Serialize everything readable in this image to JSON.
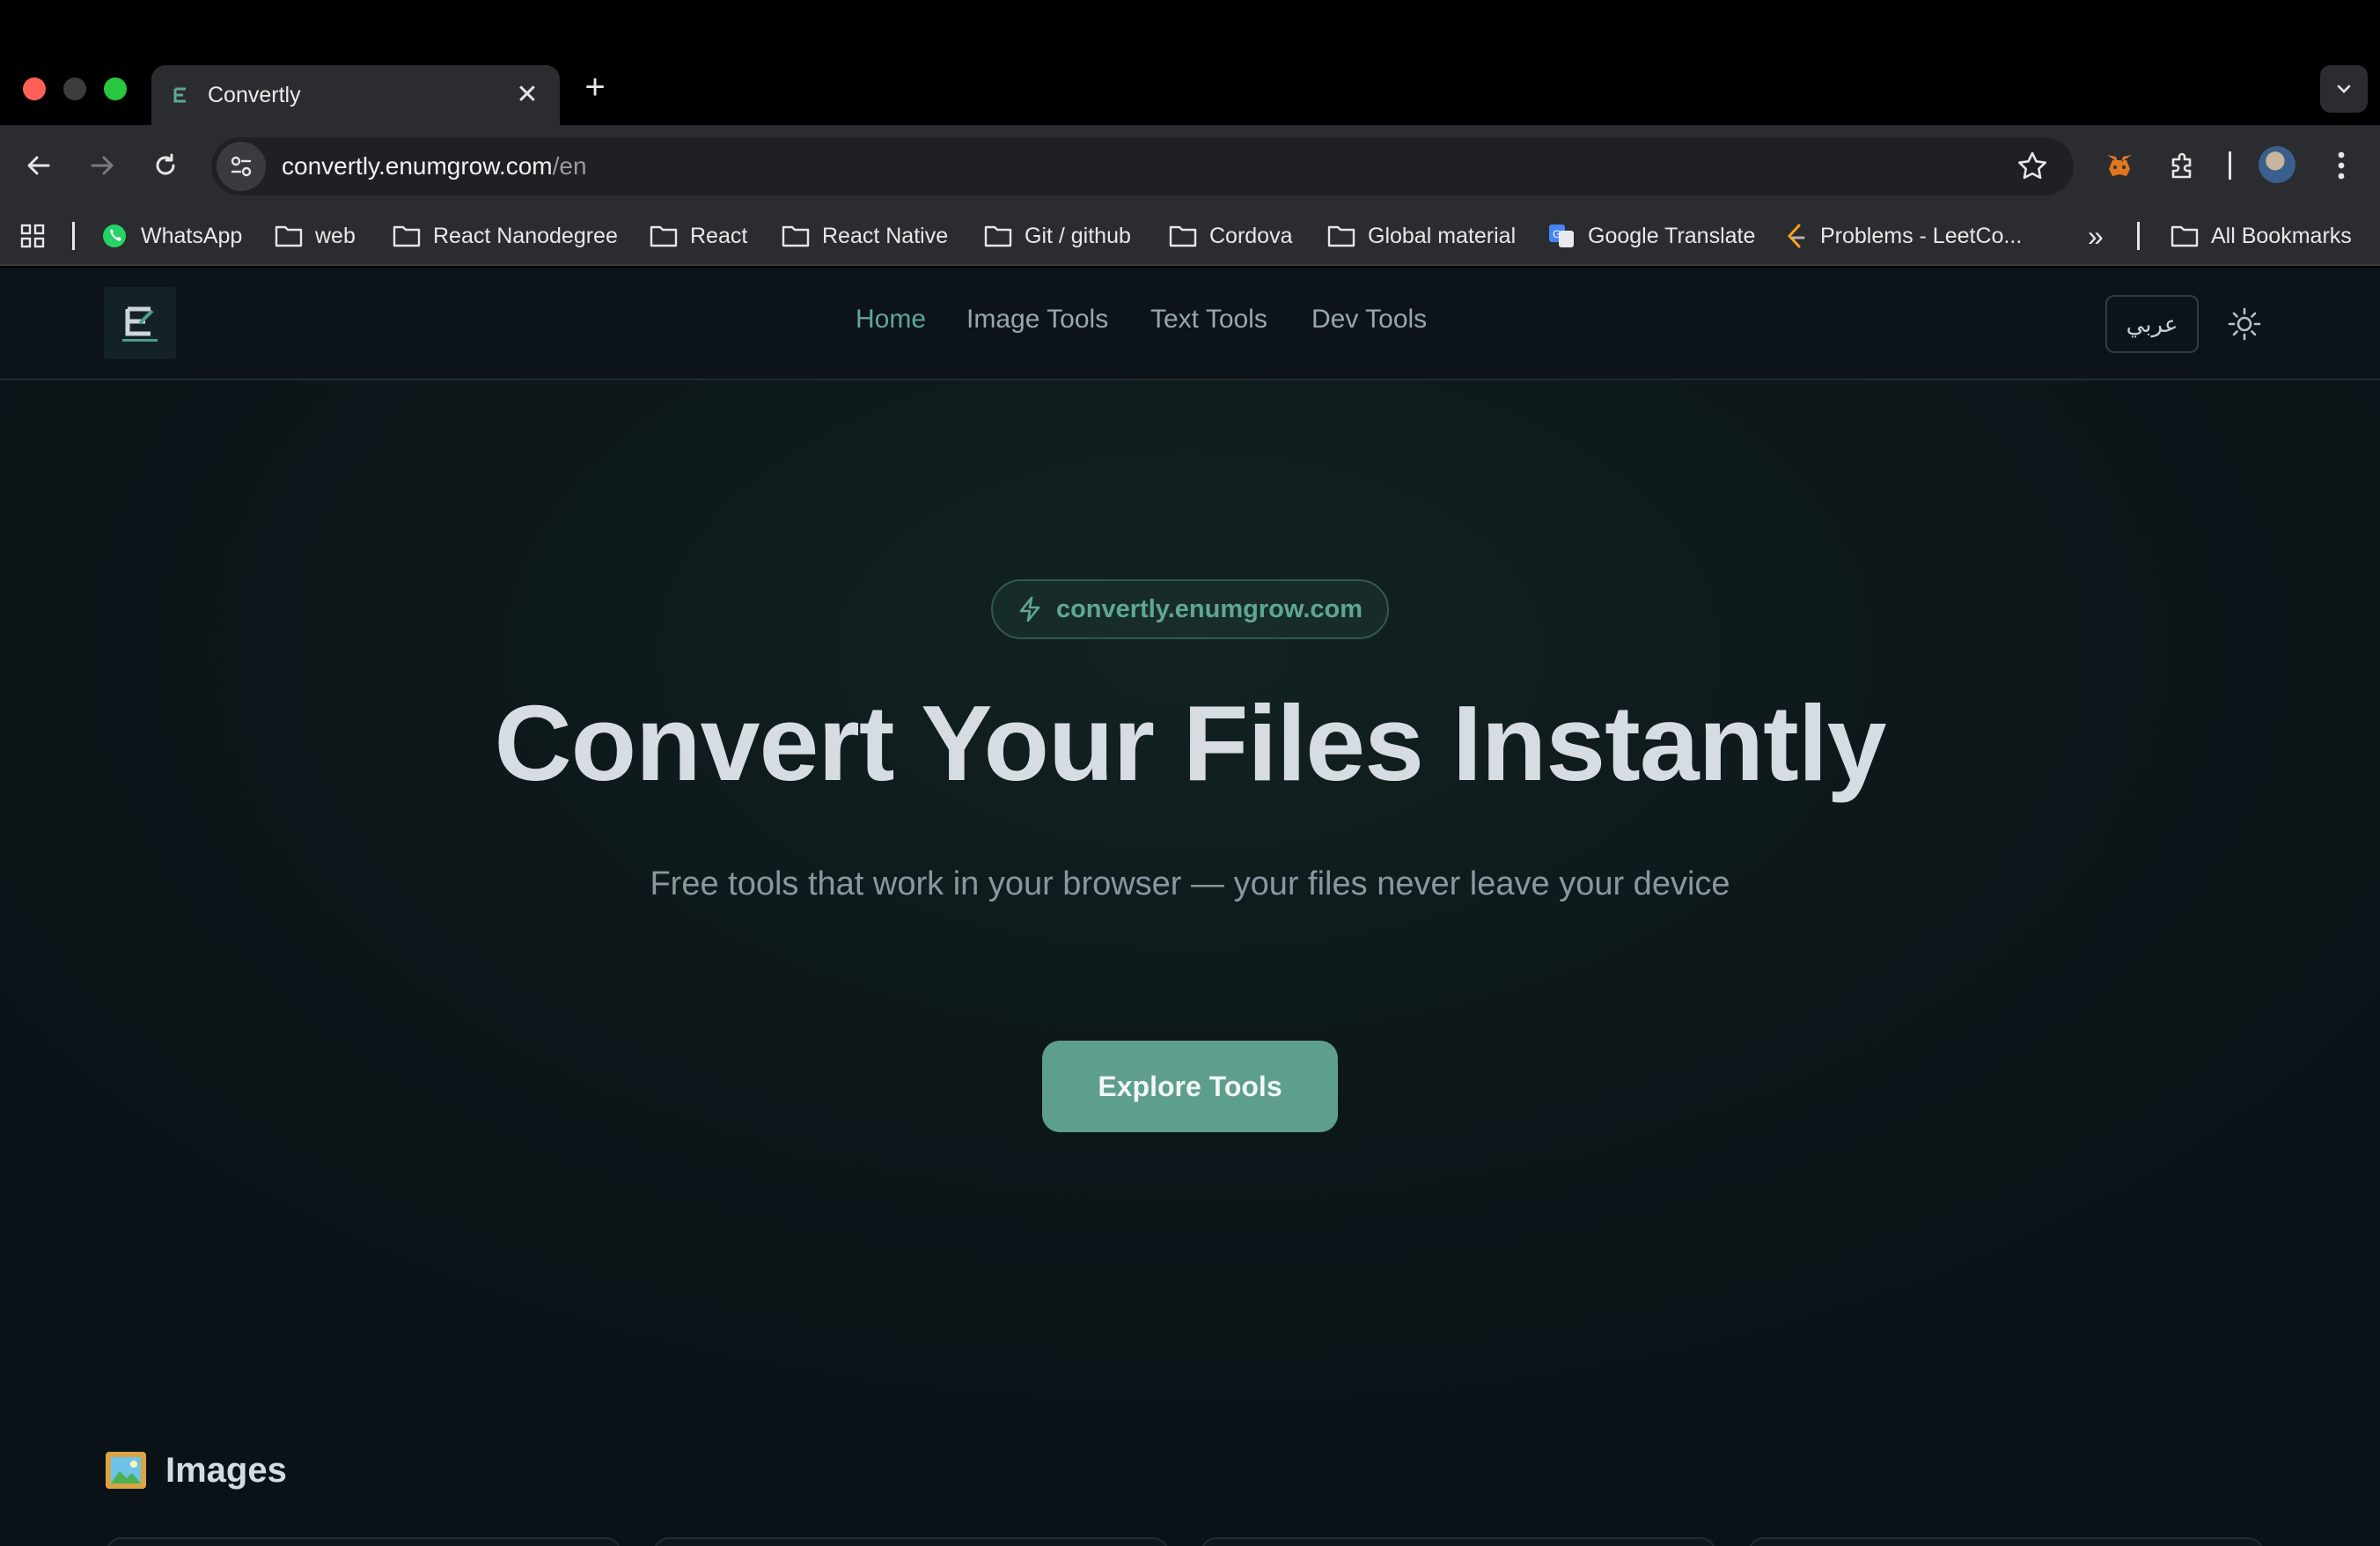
{
  "browser": {
    "tab": {
      "title": "Convertly",
      "close_glyph": "✕"
    },
    "new_tab_glyph": "+",
    "omnibox": {
      "host": "convertly.enumgrow.com",
      "path": "/en"
    },
    "bookmarks": [
      {
        "label": "WhatsApp",
        "icon": "whatsapp-icon"
      },
      {
        "label": "web",
        "icon": "folder-icon"
      },
      {
        "label": "React Nanodegree",
        "icon": "folder-icon"
      },
      {
        "label": "React",
        "icon": "folder-icon"
      },
      {
        "label": "React Native",
        "icon": "folder-icon"
      },
      {
        "label": "Git / github",
        "icon": "folder-icon"
      },
      {
        "label": "Cordova",
        "icon": "folder-icon"
      },
      {
        "label": "Global material",
        "icon": "folder-icon"
      },
      {
        "label": "Google Translate",
        "icon": "google-translate-icon"
      },
      {
        "label": "Problems - LeetCo...",
        "icon": "leetcode-icon"
      }
    ],
    "more_bookmarks_glyph": "»",
    "all_bookmarks": "All Bookmarks"
  },
  "site": {
    "nav": {
      "links": [
        {
          "label": "Home",
          "active": true
        },
        {
          "label": "Image Tools",
          "active": false
        },
        {
          "label": "Text Tools",
          "active": false
        },
        {
          "label": "Dev Tools",
          "active": false
        }
      ],
      "language_toggle": "عربي"
    },
    "hero": {
      "badge": "convertly.enumgrow.com",
      "title": "Convert Your Files Instantly",
      "subtitle": "Free tools that work in your browser — your files never leave your device",
      "cta": "Explore Tools"
    },
    "section": {
      "title": "Images",
      "icon": "framed-picture-icon"
    }
  },
  "colors": {
    "accent": "#5fa795",
    "cta_bg": "#5e9e8d",
    "page_bg": "#0b1217",
    "chrome_bg": "#2b2c2f"
  }
}
